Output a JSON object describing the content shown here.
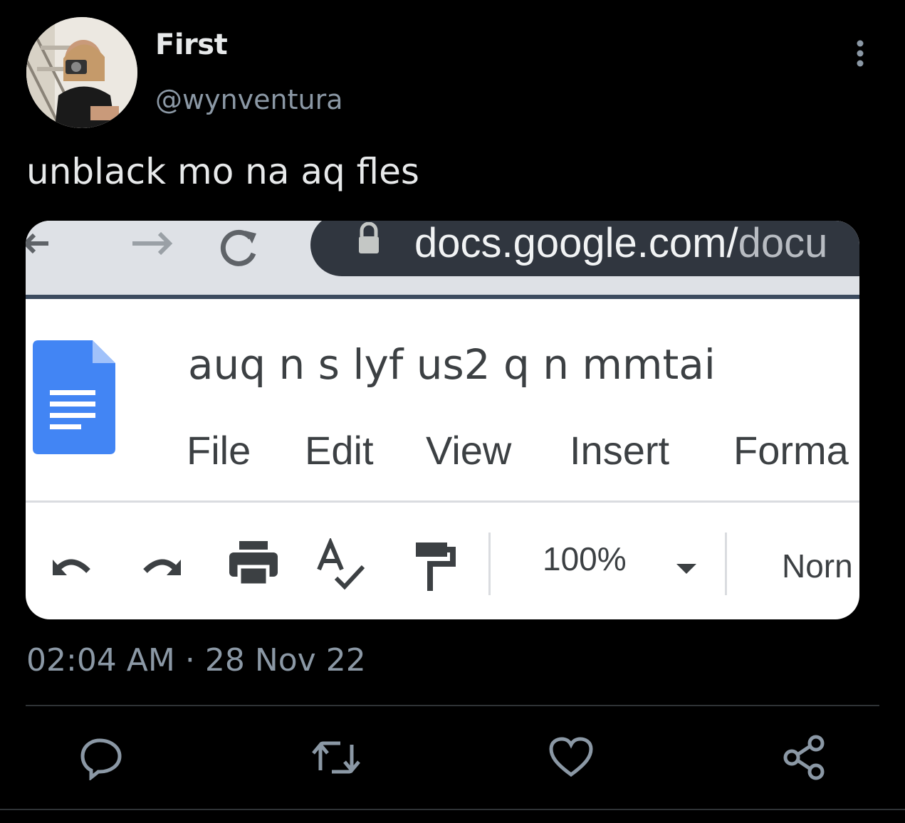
{
  "author": {
    "display_name": "First",
    "handle": "@wynventura"
  },
  "tweet": {
    "text": "unblack mo na aq fles",
    "time": "02:04 AM",
    "separator": "·",
    "date": "28 Nov 22"
  },
  "media": {
    "url_main": "docs.google.com/",
    "url_tail": "docu",
    "doc_title": "auq n s lyf us2 q n mmtai",
    "menu": [
      "File",
      "Edit",
      "View",
      "Insert",
      "Forma"
    ],
    "zoom": "100%",
    "paragraph_style": "Norn"
  },
  "icons": {
    "more": "more-vertical-icon",
    "reply": "reply-icon",
    "retweet": "retweet-icon",
    "like": "heart-icon",
    "share": "share-icon"
  },
  "colors": {
    "background": "#000000",
    "text": "#e7e9ea",
    "secondary": "#8b98a5",
    "docs_blue": "#4285f4"
  }
}
